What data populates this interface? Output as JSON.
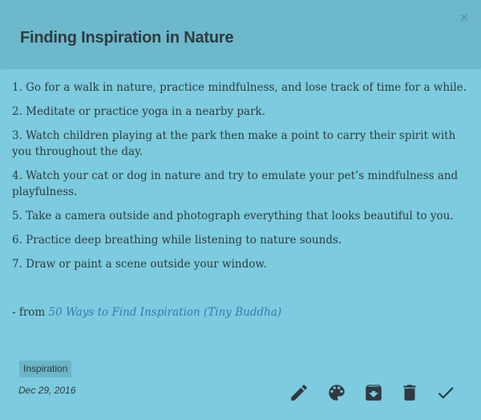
{
  "note": {
    "title": "Finding Inspiration in Nature",
    "close_label": "×",
    "items": [
      "1. Go for a walk in nature, practice mindfulness, and lose track of time for a while.",
      "2. Meditate or practice yoga in a nearby park.",
      "3. Watch children playing at the park then make a point to carry their spirit with you throughout the day.",
      "4. Watch your cat or dog in nature and try to emulate your pet’s mindfulness and playfulness.",
      "5. Take a camera outside and photograph everything that looks beautiful to you.",
      "6. Practice deep breathing while listening to nature sounds.",
      "7. Draw or paint a scene outside your window."
    ],
    "source_prefix": "- from ",
    "source_link": "50 Ways to Find Inspiration (Tiny Buddha)",
    "tag": "Inspiration",
    "date": "Dec 29, 2016"
  },
  "toolbar": {
    "icons": [
      "pencil-icon",
      "palette-icon",
      "archive-icon",
      "trash-icon",
      "check-icon"
    ]
  },
  "colors": {
    "background": "#7ccbdf",
    "header": "#6bb9cb",
    "text": "#2f3a40",
    "link": "#2f7ea9",
    "tag_bg": "#6bb5c6"
  }
}
